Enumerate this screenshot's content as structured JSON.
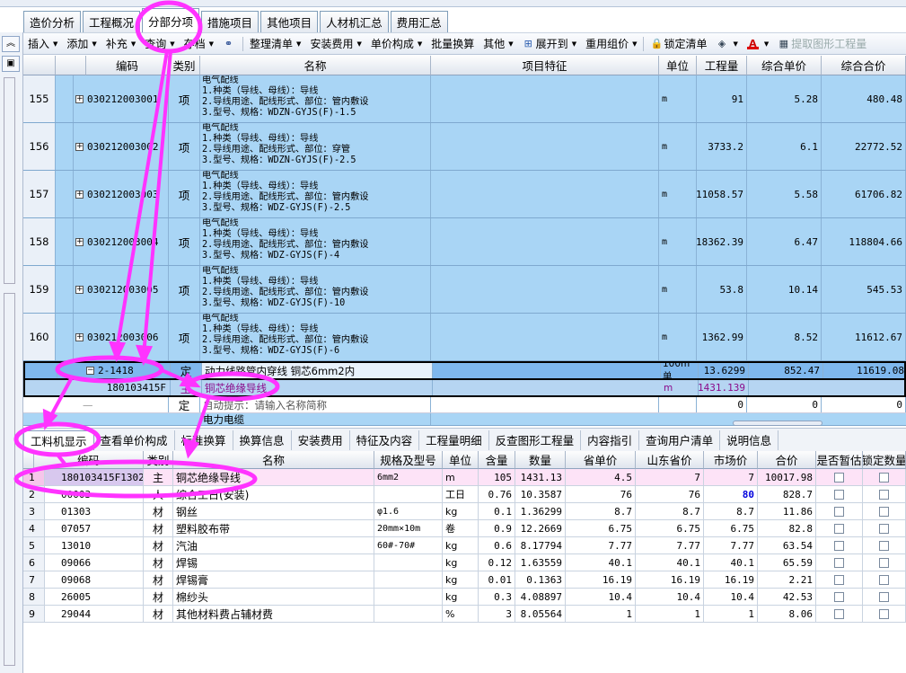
{
  "tabs": [
    {
      "label": "造价分析",
      "active": false
    },
    {
      "label": "工程概况",
      "active": false
    },
    {
      "label": "分部分项",
      "active": true
    },
    {
      "label": "措施项目",
      "active": false
    },
    {
      "label": "其他项目",
      "active": false
    },
    {
      "label": "人材机汇总",
      "active": false
    },
    {
      "label": "费用汇总",
      "active": false
    }
  ],
  "toolbar": [
    {
      "label": "插入",
      "dropdown": true,
      "icon": ""
    },
    {
      "label": "添加",
      "dropdown": true,
      "icon": ""
    },
    {
      "label": "补充",
      "dropdown": true,
      "icon": ""
    },
    {
      "label": "查询",
      "dropdown": true,
      "icon": ""
    },
    {
      "label": "存档",
      "dropdown": true,
      "icon": ""
    },
    {
      "label": "",
      "dropdown": false,
      "icon": "binoculars-icon"
    },
    {
      "label": "整理清单",
      "dropdown": true,
      "icon": ""
    },
    {
      "label": "安装费用",
      "dropdown": true,
      "icon": ""
    },
    {
      "label": "单价构成",
      "dropdown": true,
      "icon": ""
    },
    {
      "label": "批量换算",
      "dropdown": false,
      "icon": ""
    },
    {
      "label": "其他",
      "dropdown": true,
      "icon": ""
    },
    {
      "label": "展开到",
      "dropdown": true,
      "icon": "expand-icon"
    },
    {
      "label": "重用组价",
      "dropdown": true,
      "icon": ""
    },
    {
      "label": "锁定清单",
      "dropdown": false,
      "icon": "lock-icon"
    },
    {
      "label": "",
      "dropdown": true,
      "icon": "paint-bucket-icon"
    },
    {
      "label": "",
      "dropdown": true,
      "icon": "font-color-icon"
    },
    {
      "label": "提取图形工程量",
      "dropdown": false,
      "icon": "extract-icon",
      "disabled": true
    }
  ],
  "upper_grid": {
    "headers": [
      "编码",
      "类别",
      "名称",
      "项目特征",
      "单位",
      "工程量",
      "综合单价",
      "综合合价"
    ],
    "rows": [
      {
        "rownum": "155",
        "code": "030212003001",
        "type": "项",
        "name": "",
        "features": "电气配线\n1.种类（导线、母线）：导线\n2.导线用途、配线形式、部位：管内敷设\n3.型号、规格：WDZN-GYJS(F)-1.5",
        "unit": "m",
        "qty": "91",
        "price": "5.28",
        "total": "480.48"
      },
      {
        "rownum": "156",
        "code": "030212003002",
        "type": "项",
        "name": "",
        "features": "电气配线\n1.种类（导线、母线）：导线\n2.导线用途、配线形式、部位：穿管\n3.型号、规格：WDZN-GYJS(F)-2.5",
        "unit": "m",
        "qty": "3733.2",
        "price": "6.1",
        "total": "22772.52"
      },
      {
        "rownum": "157",
        "code": "030212003003",
        "type": "项",
        "name": "",
        "features": "电气配线\n1.种类（导线、母线）：导线\n2.导线用途、配线形式、部位：管内敷设\n3.型号、规格：WDZ-GYJS(F)-2.5",
        "unit": "m",
        "qty": "11058.57",
        "price": "5.58",
        "total": "61706.82"
      },
      {
        "rownum": "158",
        "code": "030212003004",
        "type": "项",
        "name": "",
        "features": "电气配线\n1.种类（导线、母线）：导线\n2.导线用途、配线形式、部位：管内敷设\n3.型号、规格：WDZ-GYJS(F)-4",
        "unit": "m",
        "qty": "18362.39",
        "price": "6.47",
        "total": "118804.66"
      },
      {
        "rownum": "159",
        "code": "030212003005",
        "type": "项",
        "name": "",
        "features": "电气配线\n1.种类（导线、母线）：导线\n2.导线用途、配线形式、部位：管内敷设\n3.型号、规格：WDZ-GYJS(F)-10",
        "unit": "m",
        "qty": "53.8",
        "price": "10.14",
        "total": "545.53"
      },
      {
        "rownum": "160",
        "code": "030212003006",
        "type": "项",
        "name": "",
        "features": "电气配线\n1.种类（导线、母线）：导线\n2.导线用途、配线形式、部位：管内敷设\n3.型号、规格：WDZ-GYJS(F)-6",
        "unit": "m",
        "qty": "1362.99",
        "price": "8.52",
        "total": "11612.67"
      }
    ],
    "quota_row": {
      "code": "2-1418",
      "type": "定",
      "name": "动力线路管内穿线 铜芯6mm2内",
      "unit": "100m单",
      "qty": "13.6299",
      "price": "852.47",
      "total": "11619.08"
    },
    "material_row": {
      "code": "180103415F",
      "type": "主",
      "name": "铜芯绝缘导线",
      "unit": "m",
      "qty": "1431.139"
    },
    "empty_row": {
      "type": "定",
      "name": "自动提示：请输入名称简称",
      "qty": "0",
      "price": "0",
      "total": "0"
    },
    "partial_row": {
      "name": "电力电缆"
    }
  },
  "lower_tabs": [
    {
      "label": "工料机显示",
      "active": true
    },
    {
      "label": "查看单价构成",
      "active": false
    },
    {
      "label": "标准换算",
      "active": false
    },
    {
      "label": "换算信息",
      "active": false
    },
    {
      "label": "安装费用",
      "active": false
    },
    {
      "label": "特征及内容",
      "active": false
    },
    {
      "label": "工程量明细",
      "active": false
    },
    {
      "label": "反查图形工程量",
      "active": false
    },
    {
      "label": "内容指引",
      "active": false
    },
    {
      "label": "查询用户清单",
      "active": false
    },
    {
      "label": "说明信息",
      "active": false
    }
  ],
  "lower_grid": {
    "headers": [
      "编码",
      "类别",
      "名称",
      "规格及型号",
      "单位",
      "含量",
      "数量",
      "省单价",
      "山东省价",
      "市场价",
      "合价",
      "是否暂估",
      "锁定数量"
    ],
    "rows": [
      {
        "rownum": "1",
        "code": "180103415F1302",
        "type": "主",
        "name": "铜芯绝缘导线",
        "spec": "6mm2",
        "unit": "m",
        "content": "105",
        "qty": "1431.13",
        "prov_price": "4.5",
        "sd_price": "7",
        "market": "7",
        "total": "10017.98",
        "selected": true
      },
      {
        "rownum": "2",
        "code": "00003",
        "type": "人",
        "name": "综合工日(安装)",
        "spec": "",
        "unit": "工日",
        "content": "0.76",
        "qty": "10.3587",
        "prov_price": "76",
        "sd_price": "76",
        "market": "80",
        "total": "828.7",
        "market_highlight": true
      },
      {
        "rownum": "3",
        "code": "01303",
        "type": "材",
        "name": "钢丝",
        "spec": "φ1.6",
        "unit": "kg",
        "content": "0.1",
        "qty": "1.36299",
        "prov_price": "8.7",
        "sd_price": "8.7",
        "market": "8.7",
        "total": "11.86"
      },
      {
        "rownum": "4",
        "code": "07057",
        "type": "材",
        "name": "塑料胶布带",
        "spec": "20mm×10m",
        "unit": "卷",
        "content": "0.9",
        "qty": "12.2669",
        "prov_price": "6.75",
        "sd_price": "6.75",
        "market": "6.75",
        "total": "82.8"
      },
      {
        "rownum": "5",
        "code": "13010",
        "type": "材",
        "name": "汽油",
        "spec": "60#-70#",
        "unit": "kg",
        "content": "0.6",
        "qty": "8.17794",
        "prov_price": "7.77",
        "sd_price": "7.77",
        "market": "7.77",
        "total": "63.54"
      },
      {
        "rownum": "6",
        "code": "09066",
        "type": "材",
        "name": "焊锡",
        "spec": "",
        "unit": "kg",
        "content": "0.12",
        "qty": "1.63559",
        "prov_price": "40.1",
        "sd_price": "40.1",
        "market": "40.1",
        "total": "65.59"
      },
      {
        "rownum": "7",
        "code": "09068",
        "type": "材",
        "name": "焊锡膏",
        "spec": "",
        "unit": "kg",
        "content": "0.01",
        "qty": "0.1363",
        "prov_price": "16.19",
        "sd_price": "16.19",
        "market": "16.19",
        "total": "2.21"
      },
      {
        "rownum": "8",
        "code": "26005",
        "type": "材",
        "name": "棉纱头",
        "spec": "",
        "unit": "kg",
        "content": "0.3",
        "qty": "4.08897",
        "prov_price": "10.4",
        "sd_price": "10.4",
        "market": "10.4",
        "total": "42.53"
      },
      {
        "rownum": "9",
        "code": "29044",
        "type": "材",
        "name": "其他材料费占辅材费",
        "spec": "",
        "unit": "%",
        "content": "3",
        "qty": "8.05564",
        "prov_price": "1",
        "sd_price": "1",
        "market": "1",
        "total": "8.06"
      }
    ]
  },
  "colors": {
    "accent": "#ff33ff",
    "row_blue": "#a9d5f5",
    "row_selected": "#7fb8ee",
    "market_blue": "#0000dd"
  }
}
